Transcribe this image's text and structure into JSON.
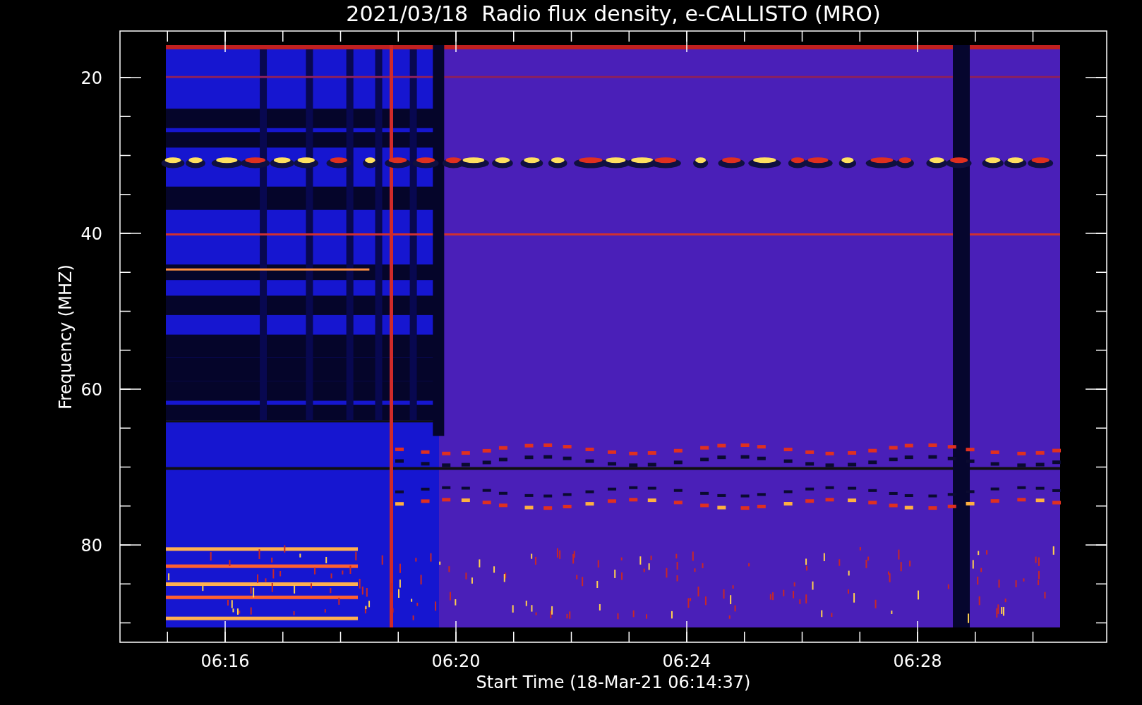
{
  "title": "2021/03/18  Radio flux density, e-CALLISTO (MRO)",
  "y_axis": {
    "label": "Frequency (MHZ)",
    "ticks": [
      "20",
      "40",
      "60",
      "80"
    ]
  },
  "x_axis": {
    "label": "Start Time (18-Mar-21 06:14:37)",
    "ticks": [
      "06:16",
      "06:20",
      "06:24",
      "06:28"
    ]
  }
}
